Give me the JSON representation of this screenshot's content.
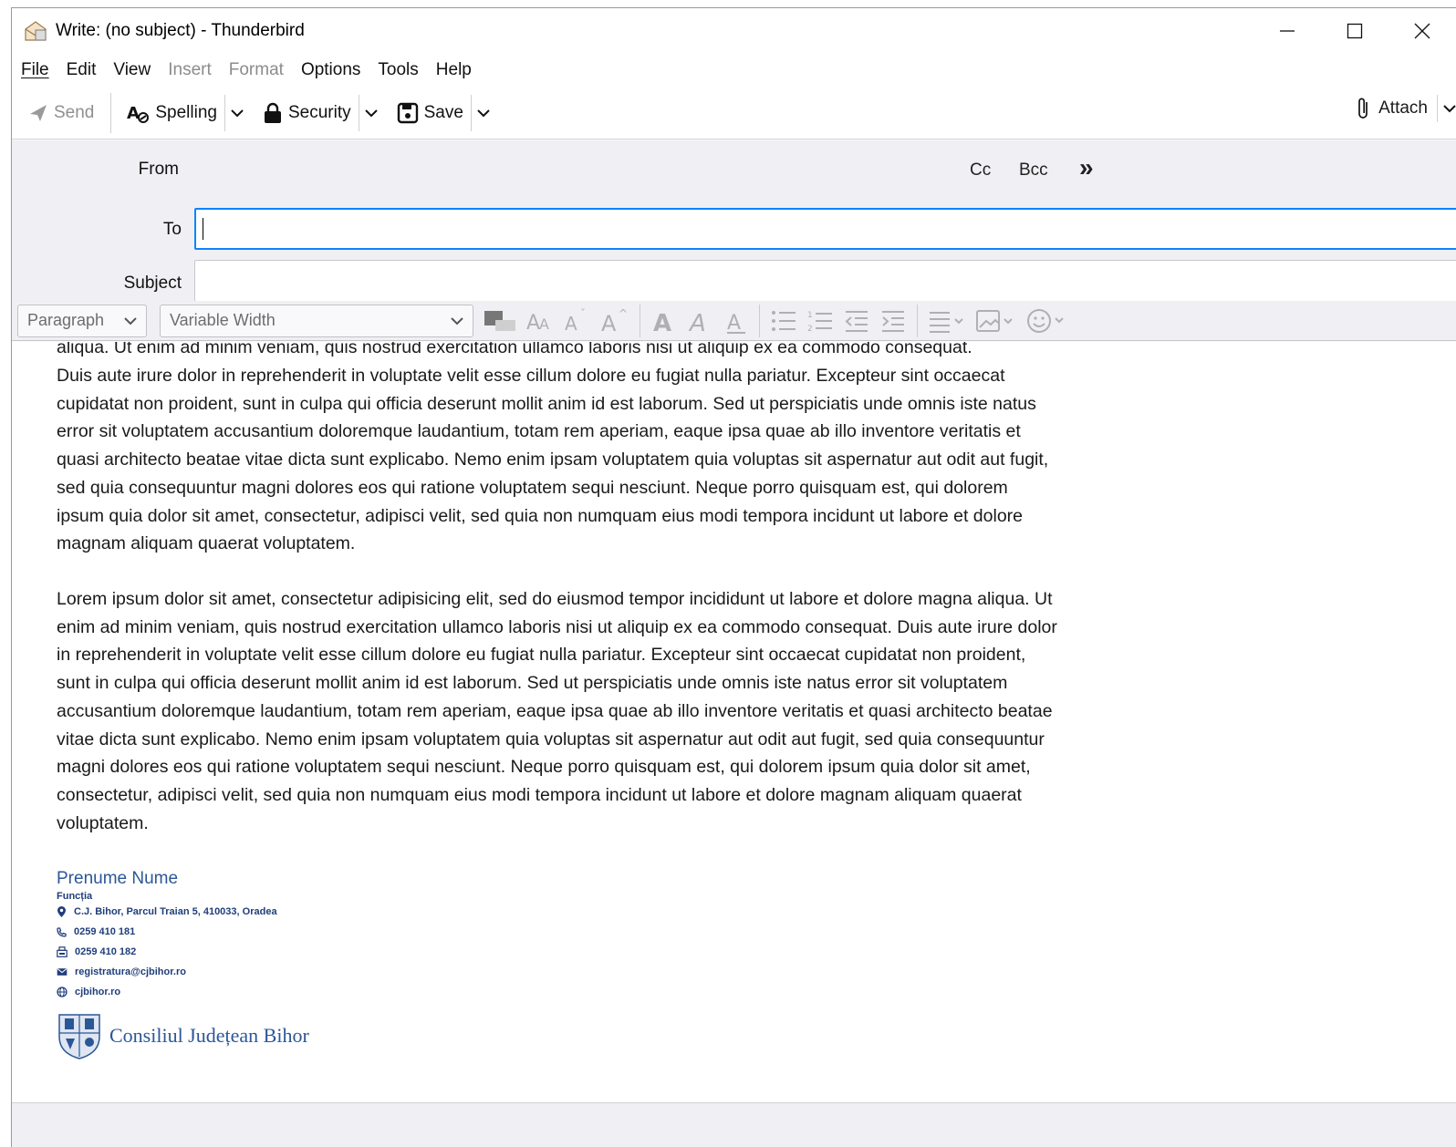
{
  "window": {
    "title": "Write: (no subject) - Thunderbird",
    "app_icon": "compose-envelope-icon"
  },
  "menu": [
    {
      "label": "File",
      "accel": "F",
      "rest": "ile",
      "disabled": false
    },
    {
      "label": "Edit",
      "accel": "E",
      "rest": "dit",
      "disabled": false
    },
    {
      "label": "View",
      "accel": "V",
      "rest": "iew",
      "disabled": false
    },
    {
      "label": "Insert",
      "accel": "I",
      "rest": "nsert",
      "disabled": true
    },
    {
      "label": "Format",
      "accel": "o",
      "rest": "",
      "disabled": true
    },
    {
      "label": "Options",
      "accel": "p",
      "rest": "",
      "disabled": false
    },
    {
      "label": "Tools",
      "accel": "T",
      "rest": "ools",
      "disabled": false
    },
    {
      "label": "Help",
      "accel": "H",
      "rest": "elp",
      "disabled": false
    }
  ],
  "toolbar": {
    "send": "Send",
    "spelling": "Spelling",
    "security": "Security",
    "save": "Save",
    "attach": "Attach"
  },
  "headers": {
    "from_label": "From",
    "to_label": "To",
    "subject_label": "Subject",
    "to_value": "",
    "subject_value": "",
    "cc": "Cc",
    "bcc": "Bcc",
    "more": "»"
  },
  "format": {
    "paragraph": "Paragraph",
    "font": "Variable Width"
  },
  "body": {
    "cut_line": "aliqua. Ut enim ad minim veniam, quis nostrud exercitation ullamco laboris nisi ut aliquip ex ea commodo consequat.",
    "para1_rest": "Duis aute irure dolor in reprehenderit in voluptate velit esse cillum dolore eu fugiat nulla pariatur. Excepteur sint occaecat cupidatat non proident, sunt in culpa qui officia deserunt mollit anim id est laborum. Sed ut perspiciatis unde omnis iste natus error sit voluptatem accusantium doloremque laudantium, totam rem aperiam, eaque ipsa quae ab illo inventore veritatis et quasi architecto beatae vitae dicta sunt explicabo. Nemo enim ipsam voluptatem quia voluptas sit aspernatur aut odit aut fugit, sed quia consequuntur magni dolores eos qui ratione voluptatem sequi nesciunt. Neque porro quisquam est, qui dolorem ipsum quia dolor sit amet, consectetur, adipisci velit, sed quia non numquam eius modi tempora incidunt ut labore et dolore magnam aliquam quaerat voluptatem.",
    "para2": "Lorem ipsum dolor sit amet, consectetur adipisicing elit, sed do eiusmod tempor incididunt ut labore et dolore magna aliqua. Ut enim ad minim veniam, quis nostrud exercitation ullamco laboris nisi ut aliquip ex ea commodo consequat. Duis aute irure dolor in reprehenderit in voluptate velit esse cillum dolore eu fugiat nulla pariatur. Excepteur sint occaecat cupidatat non proident, sunt in culpa qui officia deserunt mollit anim id est laborum. Sed ut perspiciatis unde omnis iste natus error sit voluptatem accusantium doloremque laudantium, totam rem aperiam, eaque ipsa quae ab illo inventore veritatis et quasi architecto beatae vitae dicta sunt explicabo. Nemo enim ipsam voluptatem quia voluptas sit aspernatur aut odit aut fugit, sed quia consequuntur magni dolores eos qui ratione voluptatem sequi nesciunt. Neque porro quisquam est, qui dolorem ipsum quia dolor sit amet, consectetur, adipisci velit, sed quia non numquam eius modi tempora incidunt ut labore et dolore magnam aliquam quaerat voluptatem."
  },
  "signature": {
    "name": "Prenume Nume",
    "role": "Funcția",
    "address": "C.J. Bihor, Parcul Traian 5, 410033, Oradea",
    "phone": "0259 410 181",
    "fax": "0259 410 182",
    "email": "registratura@cjbihor.ro",
    "web": "cjbihor.ro",
    "org": "Consiliul Județean Bihor"
  },
  "colors": {
    "accent": "#0a84ff",
    "signature_blue": "#2b5797"
  }
}
